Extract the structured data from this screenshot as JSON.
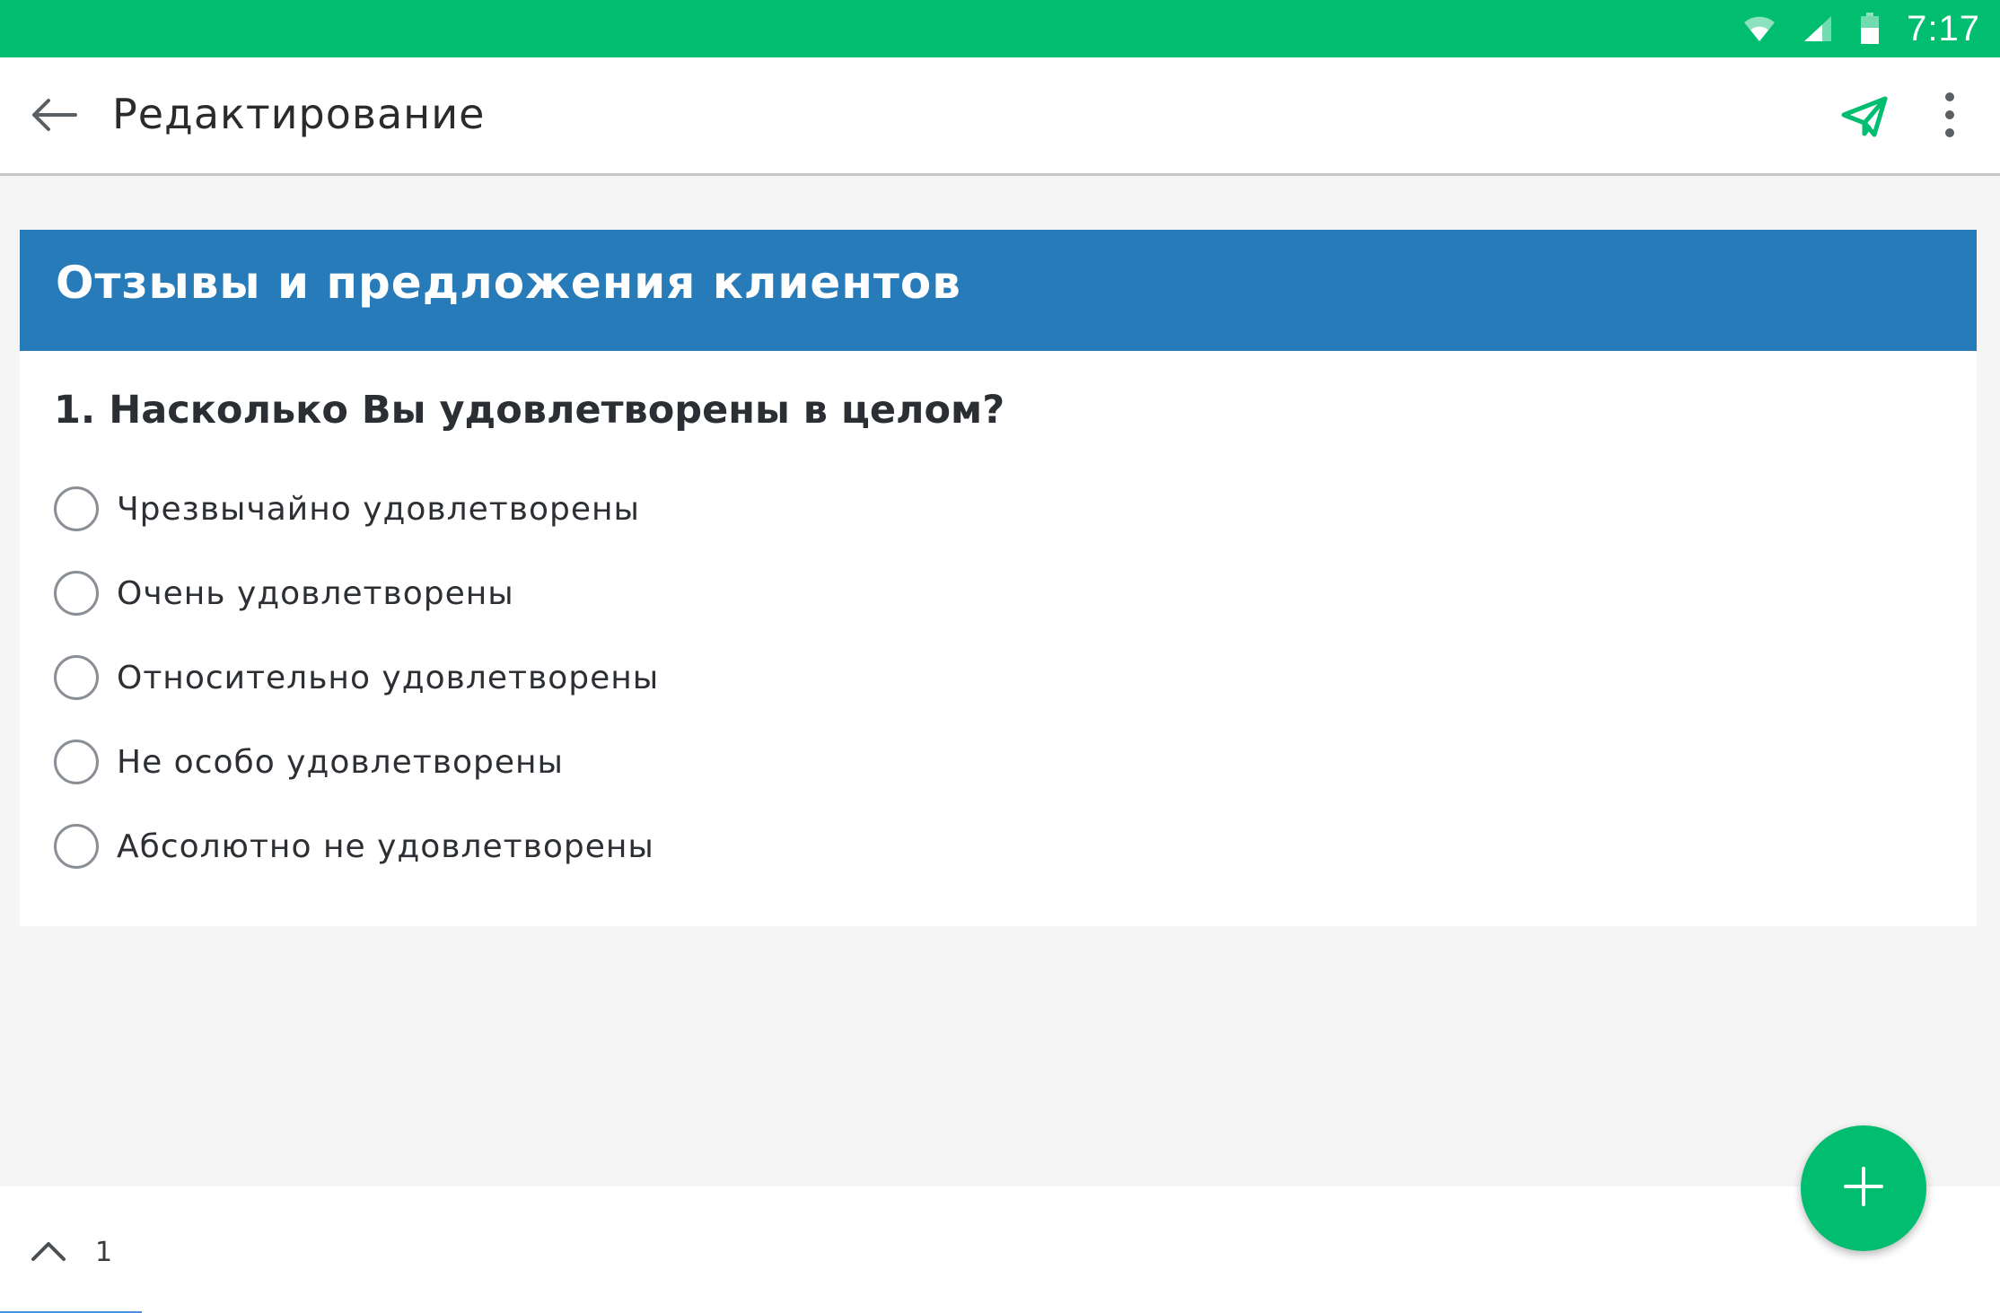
{
  "status_bar": {
    "time": "7:17",
    "icons": [
      "wifi-icon",
      "cellular-signal-icon",
      "battery-icon"
    ]
  },
  "app_bar": {
    "title": "Редактирование",
    "icons": {
      "back": "arrow-left-icon",
      "send": "paper-plane-icon",
      "more": "more-vertical-icon"
    }
  },
  "survey": {
    "title": "Отзывы и предложения клиентов",
    "question": {
      "title": "1. Насколько Вы удовлетворены в целом?",
      "options": [
        {
          "label": "Чрезвычайно удовлетворены"
        },
        {
          "label": "Очень удовлетворены"
        },
        {
          "label": "Относительно удовлетворены"
        },
        {
          "label": "Не особо удовлетворены"
        },
        {
          "label": "Абсолютно не удовлетворены"
        }
      ]
    }
  },
  "bottom_bar": {
    "page_number": "1"
  },
  "fab": {
    "icon": "plus-icon"
  },
  "colors": {
    "status_bar": "#00bd6f",
    "accent": "#00bd6f",
    "survey_header": "#277bb8",
    "background": "#f4f5f4"
  }
}
